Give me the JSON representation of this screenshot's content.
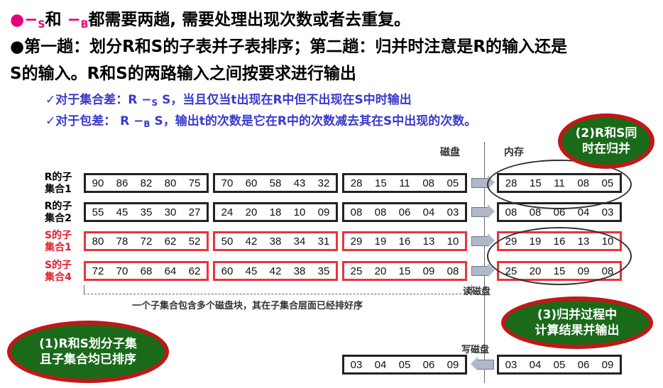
{
  "header": {
    "line1_prefix": "●",
    "line1_op1": "−",
    "line1_op1_sub": "S",
    "line1_mid": "和 ",
    "line1_op2": "−",
    "line1_op2_sub": "B",
    "line1_rest": "都需要两趟, 需要处理出现次数或者去重复。",
    "line2": "●第一趟：划分R和S的子表并子表排序；第二趟：归并时注意是R的输入还是",
    "line3": "S的输入。R和S的两路输入之间按要求进行输出"
  },
  "checks": [
    {
      "pre": "✓对于集合差：R ",
      "op": "−",
      "sub": "S",
      "post": " S，当且仅当t出现在R中但不出现在S中时输出"
    },
    {
      "pre": "✓对于包差：  R ",
      "op": "−",
      "sub": "B",
      "post": " S，输出t的次数是它在R中的次数减去其在S中出现的次数。"
    }
  ],
  "labels": {
    "disk": "磁盘",
    "memory": "内存",
    "read_disk": "读磁盘",
    "write_disk": "写磁盘",
    "brace_note": "一个子集合包含多个磁盘块，其在子集合层面已经排好序"
  },
  "rows": [
    {
      "label": "R的子\n集合1",
      "color": "black",
      "blocks": [
        [
          "90",
          "86",
          "82",
          "80",
          "75"
        ],
        [
          "70",
          "60",
          "58",
          "43",
          "32"
        ],
        [
          "28",
          "15",
          "11",
          "08",
          "05"
        ]
      ],
      "memory": [
        "28",
        "15",
        "11",
        "08",
        "05"
      ]
    },
    {
      "label": "R的子\n集合2",
      "color": "black",
      "blocks": [
        [
          "55",
          "45",
          "35",
          "30",
          "27"
        ],
        [
          "24",
          "20",
          "18",
          "10",
          "09"
        ],
        [
          "08",
          "08",
          "06",
          "04",
          "03"
        ]
      ],
      "memory": [
        "08",
        "08",
        "06",
        "04",
        "03"
      ]
    },
    {
      "label": "S的子\n集合1",
      "color": "red",
      "blocks": [
        [
          "80",
          "78",
          "72",
          "62",
          "52"
        ],
        [
          "50",
          "42",
          "38",
          "34",
          "31"
        ],
        [
          "29",
          "19",
          "16",
          "13",
          "10"
        ]
      ],
      "memory": [
        "29",
        "19",
        "16",
        "13",
        "10"
      ]
    },
    {
      "label": "S的子\n集合4",
      "color": "red",
      "blocks": [
        [
          "72",
          "70",
          "68",
          "64",
          "62"
        ],
        [
          "60",
          "45",
          "42",
          "38",
          "35"
        ],
        [
          "25",
          "20",
          "15",
          "09",
          "08"
        ]
      ],
      "memory": [
        "25",
        "20",
        "15",
        "09",
        "08"
      ]
    }
  ],
  "output": {
    "disk_block": [
      "03",
      "04",
      "05",
      "06",
      "09"
    ],
    "mem_block": [
      "03",
      "04",
      "05",
      "06",
      "09"
    ]
  },
  "notes": {
    "note1": "(1)R和S划分子集\n且子集合均已排序",
    "note2": "(2)R和S同\n时在归并",
    "note3": "(3)归并过程中\n计算结果并输出"
  },
  "colors": {
    "accent_pink": "#e8007a",
    "check_blue": "#3a3acc",
    "red_border": "#e8343a",
    "note_green": "#1a6a1a",
    "note_ring": "#c01818"
  }
}
